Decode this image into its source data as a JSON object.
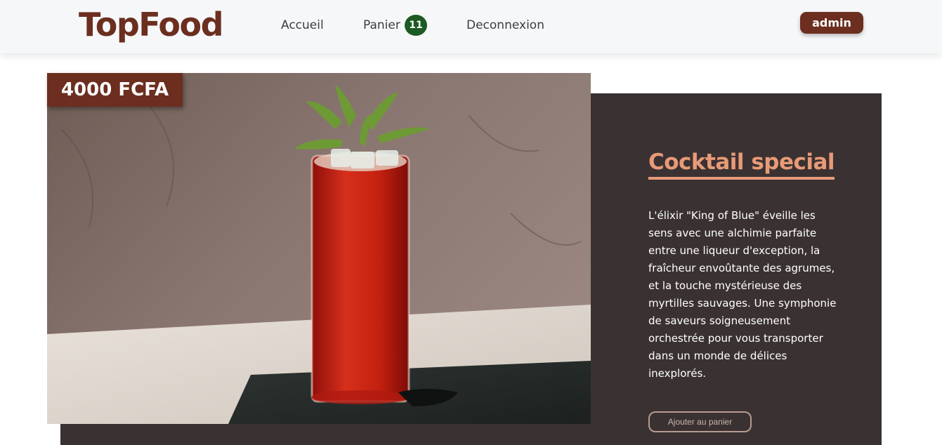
{
  "navbar": {
    "brand": "TopFood",
    "links": {
      "home": "Accueil",
      "cart": "Panier",
      "logout": "Deconnexion"
    },
    "cart_count": "11",
    "user_button": "admin"
  },
  "product": {
    "price": "4000 FCFA",
    "title": "Cocktail special",
    "description": "L'élixir \"King of Blue\" éveille les sens avec une alchimie parfaite entre une liqueur d'exception, la fraîcheur envoûtante des agrumes, et la touche mystérieuse des myrtilles sauvages. Une symphonie de saveurs soigneusement orchestrée pour vous transporter dans un monde de délices inexplorés.",
    "add_to_cart": "Ajouter au panier",
    "image": "cocktail-glass-image"
  },
  "colors": {
    "brand": "#6b2e1f",
    "badge": "#1c5a23",
    "panel": "#3a3232",
    "accent": "#e89a78"
  }
}
